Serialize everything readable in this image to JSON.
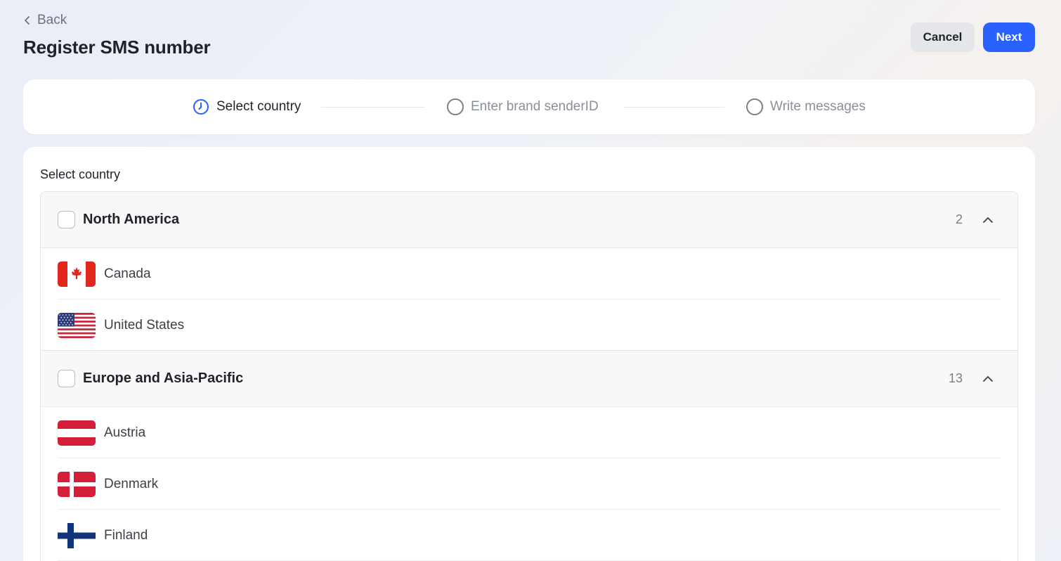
{
  "header": {
    "back_label": "Back",
    "title": "Register SMS number",
    "cancel_label": "Cancel",
    "next_label": "Next"
  },
  "steps": [
    {
      "label": "Select country",
      "state": "active"
    },
    {
      "label": "Enter brand senderID",
      "state": "pending"
    },
    {
      "label": "Write messages",
      "state": "pending"
    }
  ],
  "section_label": "Select country",
  "groups": [
    {
      "name": "North America",
      "count": "2",
      "countries": [
        "Canada",
        "United States"
      ]
    },
    {
      "name": "Europe and Asia-Pacific",
      "count": "13",
      "countries": [
        "Austria",
        "Denmark",
        "Finland"
      ]
    }
  ],
  "colors": {
    "accent": "#2962ff",
    "active_step": "#2962ff"
  }
}
